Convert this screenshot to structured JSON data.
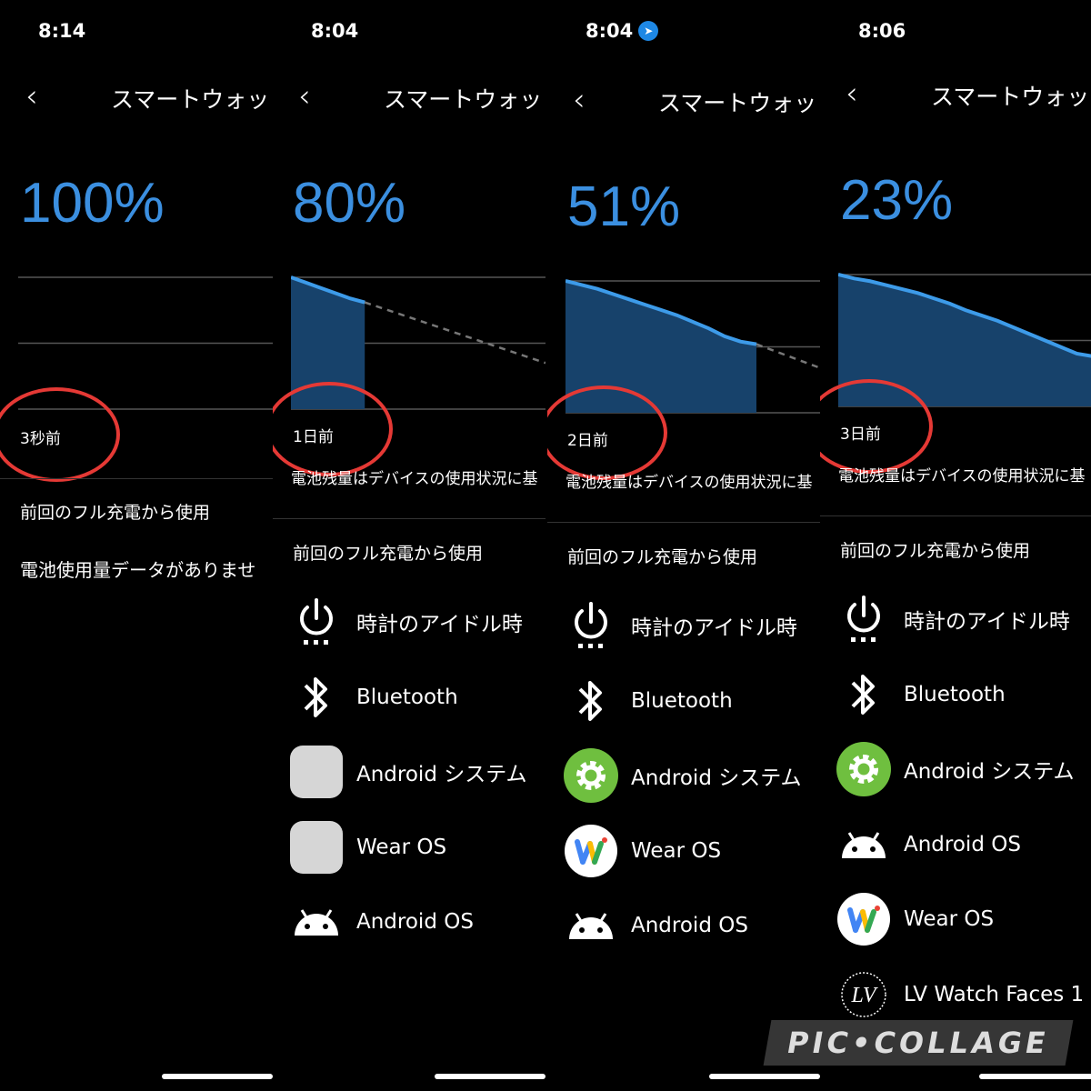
{
  "panels": [
    {
      "status_time": "8:14",
      "title": "スマートウォッ",
      "percent": "100%",
      "ago": "3秒前",
      "section_header": "前回のフル充電から使用",
      "no_data": "電池使用量データがありませ"
    },
    {
      "status_time": "8:04",
      "title": "スマートウォッ",
      "percent": "80%",
      "ago": "1日前",
      "disclaimer": "電池残量はデバイスの使用状況に基",
      "section_header": "前回のフル充電から使用",
      "apps": [
        {
          "label": "時計のアイドル時",
          "icon": "power-icon"
        },
        {
          "label": "Bluetooth",
          "icon": "bluetooth-icon"
        },
        {
          "label": "Android システム",
          "icon": "placeholder-app-icon"
        },
        {
          "label": "Wear OS",
          "icon": "placeholder-app-icon"
        },
        {
          "label": "Android OS",
          "icon": "android-icon"
        }
      ]
    },
    {
      "status_time": "8:04",
      "location_icon": "location-arrow-icon",
      "title": "スマートウォッ",
      "percent": "51%",
      "ago": "2日前",
      "disclaimer": "電池残量はデバイスの使用状況に基",
      "section_header": "前回のフル充電から使用",
      "apps": [
        {
          "label": "時計のアイドル時",
          "icon": "power-icon"
        },
        {
          "label": "Bluetooth",
          "icon": "bluetooth-icon"
        },
        {
          "label": "Android システム",
          "icon": "gear-icon"
        },
        {
          "label": "Wear OS",
          "icon": "wear-os-icon"
        },
        {
          "label": "Android OS",
          "icon": "android-icon"
        }
      ]
    },
    {
      "status_time": "8:06",
      "title": "スマートウォッ",
      "percent": "23%",
      "ago": "3日前",
      "disclaimer": "電池残量はデバイスの使用状況に基",
      "section_header": "前回のフル充電から使用",
      "apps": [
        {
          "label": "時計のアイドル時",
          "icon": "power-icon"
        },
        {
          "label": "Bluetooth",
          "icon": "bluetooth-icon"
        },
        {
          "label": "Android システム",
          "icon": "gear-icon"
        },
        {
          "label": "Android OS",
          "icon": "android-icon"
        },
        {
          "label": "Wear OS",
          "icon": "wear-os-icon"
        },
        {
          "label": "LV Watch Faces 1",
          "icon": "lv-logo-icon"
        }
      ]
    }
  ],
  "chart_data": [
    {
      "type": "area",
      "ylim": [
        0,
        100
      ],
      "grid": true,
      "values": []
    },
    {
      "type": "area",
      "ylim": [
        0,
        100
      ],
      "grid": true,
      "values": [
        100,
        96,
        92,
        88,
        84,
        81
      ],
      "projection_end": 35
    },
    {
      "type": "area",
      "ylim": [
        0,
        100
      ],
      "grid": true,
      "values": [
        100,
        97,
        94,
        90,
        86,
        82,
        78,
        74,
        69,
        64,
        58,
        54,
        52
      ],
      "projection_end": 34
    },
    {
      "type": "area",
      "ylim": [
        0,
        100
      ],
      "grid": true,
      "values": [
        100,
        97,
        95,
        92,
        89,
        86,
        82,
        78,
        73,
        69,
        65,
        60,
        55,
        50,
        45,
        40,
        38
      ]
    }
  ],
  "colors": {
    "accent": "#3b8fe0",
    "fill": "#17426b",
    "line": "#3d9be9",
    "annotation": "#e53935"
  },
  "watermark": "PIC•COLLAGE"
}
